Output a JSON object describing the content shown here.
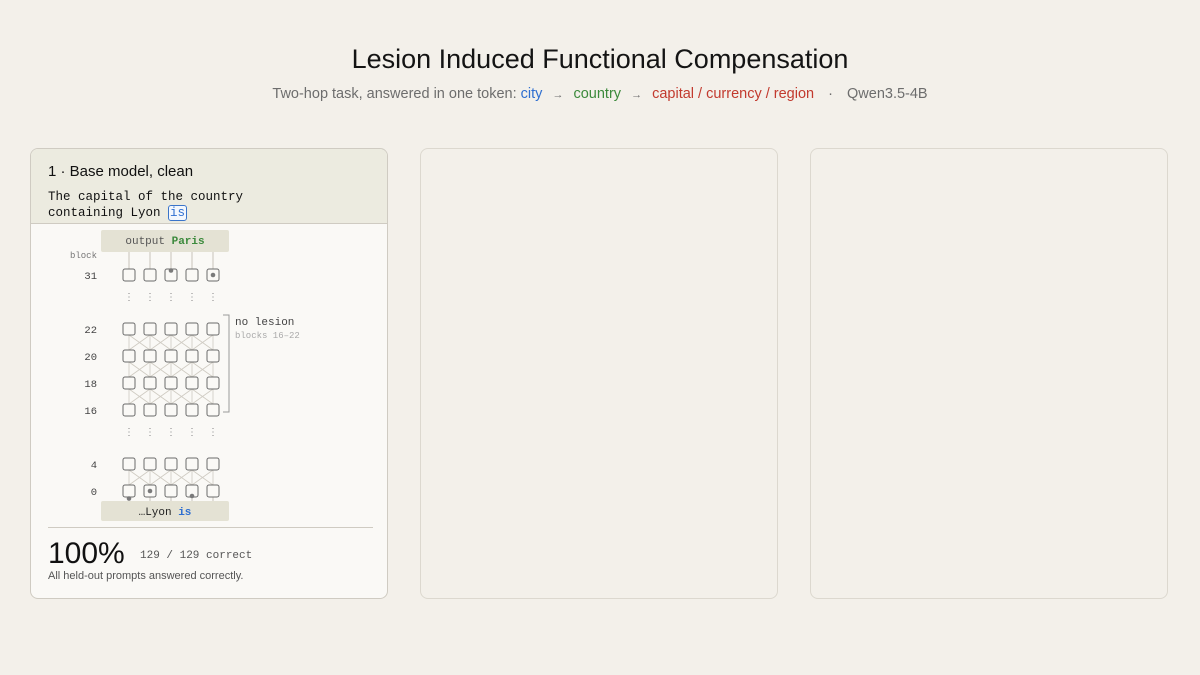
{
  "header": {
    "title": "Lesion Induced Functional Compensation",
    "subtitle_prefix": "Two-hop task, answered in one token:",
    "hop_city": "city",
    "hop_arrow_1": "→",
    "hop_country": "country",
    "hop_arrow_2": "→",
    "hop_target": "capital / currency / region",
    "separator": "·",
    "model": "Qwen3.5-4B"
  },
  "panels": [
    {
      "title": "1 · Base model, clean",
      "prompt_line1": "The capital of the country",
      "prompt_line2": "containing Lyon ",
      "prompt_token": "is",
      "diagram": {
        "output_label": "output",
        "output_value": "Paris",
        "block_axis_label": "block",
        "block_labels": [
          "31",
          "22",
          "20",
          "18",
          "16",
          "4",
          "0"
        ],
        "ellipsis_glyph": "⋮",
        "lesion_label": "no lesion",
        "lesion_range": "blocks 16–22",
        "input_prefix": "…Lyon ",
        "input_token": "is"
      },
      "accuracy": "100%",
      "correct_count": "129 / 129 correct",
      "note": "All held-out prompts answered correctly."
    },
    {},
    {}
  ],
  "colors": {
    "city": "#2f6fd0",
    "country": "#3c8a3c",
    "target": "#c23a2e",
    "panel_header_bg": "#ecebe0",
    "page_bg": "#f3f0ea"
  }
}
